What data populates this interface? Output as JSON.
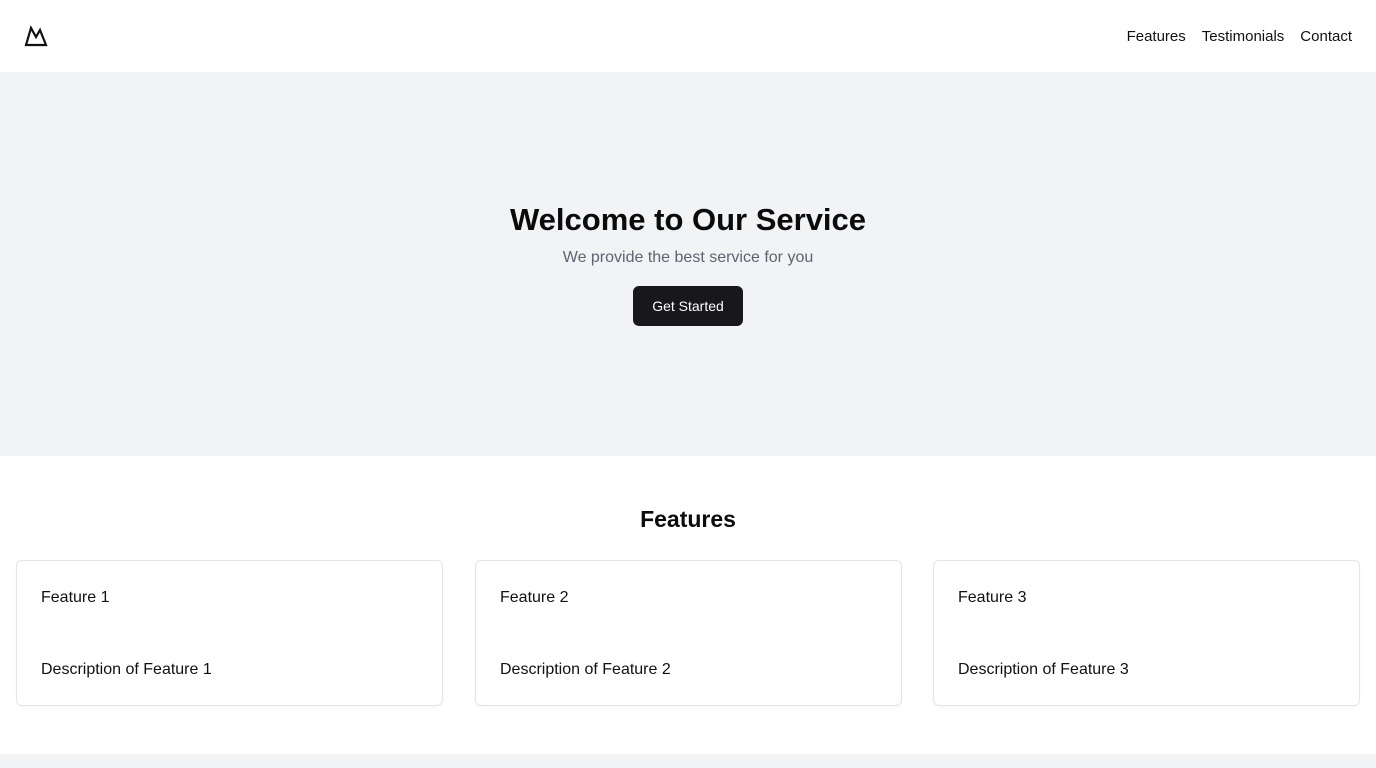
{
  "header": {
    "logo_icon": "mountain-logo-icon",
    "nav": [
      {
        "label": "Features"
      },
      {
        "label": "Testimonials"
      },
      {
        "label": "Contact"
      }
    ]
  },
  "hero": {
    "title": "Welcome to Our Service",
    "subtitle": "We provide the best service for you",
    "cta_label": "Get Started"
  },
  "features": {
    "title": "Features",
    "cards": [
      {
        "title": "Feature 1",
        "description": "Description of Feature 1"
      },
      {
        "title": "Feature 2",
        "description": "Description of Feature 2"
      },
      {
        "title": "Feature 3",
        "description": "Description of Feature 3"
      }
    ]
  },
  "colors": {
    "hero_background": "#f2f3f5",
    "button_background": "#18181b",
    "button_text": "#ffffff",
    "subtitle_text": "#5d6470"
  }
}
